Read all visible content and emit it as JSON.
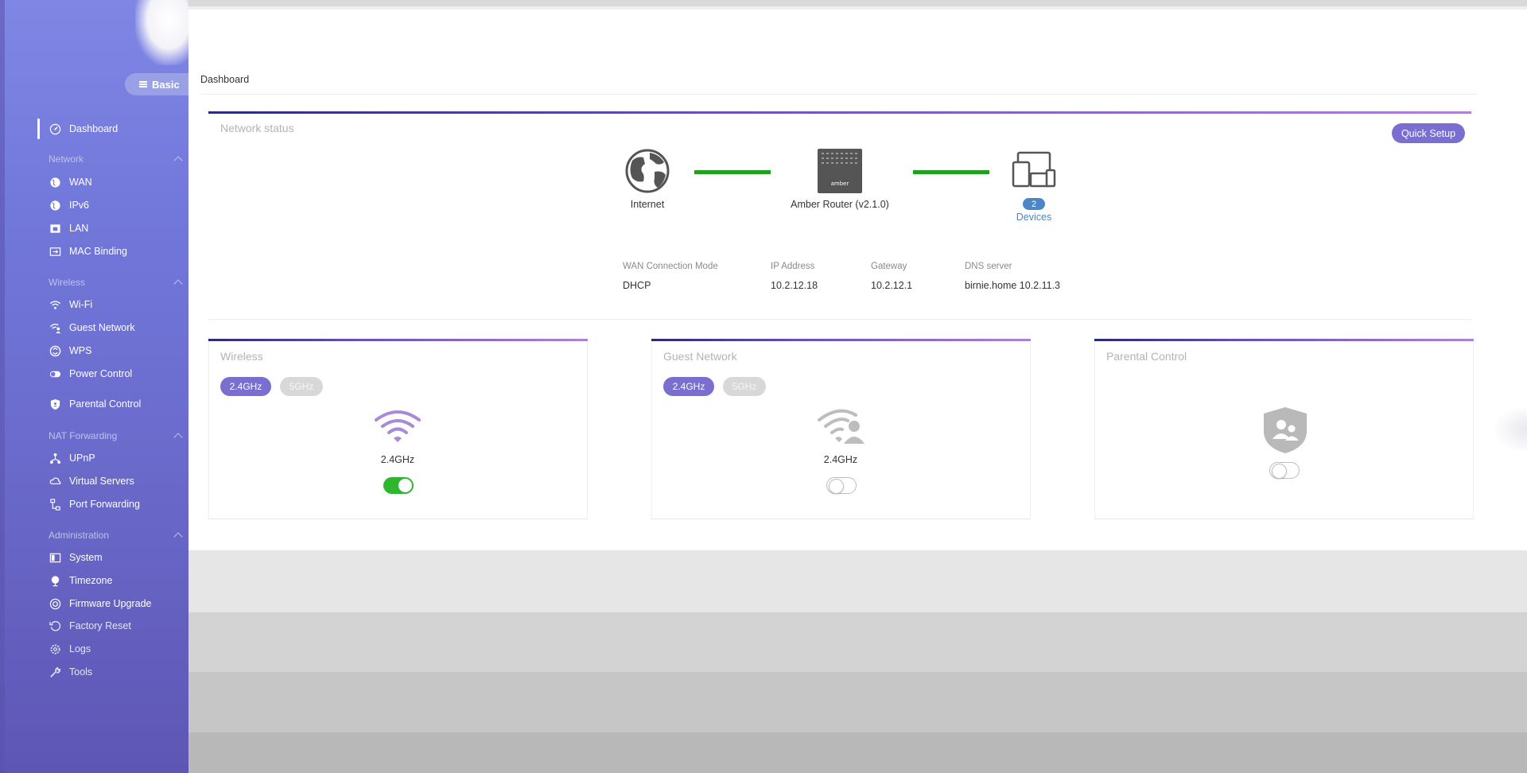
{
  "sidebar": {
    "mode_button": "Basic",
    "items": {
      "dashboard": "Dashboard",
      "wan": "WAN",
      "ipv6": "IPv6",
      "lan": "LAN",
      "mac_binding": "MAC Binding",
      "wifi": "Wi-Fi",
      "guest_network": "Guest Network",
      "wps": "WPS",
      "power_control": "Power Control",
      "parental_control": "Parental Control",
      "upnp": "UPnP",
      "virtual_servers": "Virtual Servers",
      "port_forwarding": "Port Forwarding",
      "system": "System",
      "timezone": "Timezone",
      "firmware_upgrade": "Firmware Upgrade",
      "factory_reset": "Factory Reset",
      "logs": "Logs",
      "tools": "Tools"
    },
    "sections": {
      "network": "Network",
      "wireless": "Wireless",
      "nat_forwarding": "NAT Forwarding",
      "administration": "Administration"
    }
  },
  "breadcrumb": "Dashboard",
  "network_status": {
    "title": "Network status",
    "quick_setup": "Quick Setup",
    "internet_label": "Internet",
    "router_label": "Amber Router (v2.1.0)",
    "router_brand": "amber",
    "devices_count": "2",
    "devices_label": "Devices",
    "info": {
      "wan_mode_label": "WAN Connection Mode",
      "wan_mode_value": "DHCP",
      "ip_label": "IP Address",
      "ip_value": "10.2.12.18",
      "gateway_label": "Gateway",
      "gateway_value": "10.2.12.1",
      "dns_label": "DNS server",
      "dns_value": "birnie.home 10.2.11.3"
    }
  },
  "wireless_card": {
    "title": "Wireless",
    "band_24": "2.4GHz",
    "band_5": "5GHz",
    "active_band_label": "2.4GHz",
    "enabled": true
  },
  "guest_card": {
    "title": "Guest Network",
    "band_24": "2.4GHz",
    "band_5": "5GHz",
    "active_band_label": "2.4GHz",
    "enabled": false
  },
  "parental_card": {
    "title": "Parental Control",
    "enabled": false
  },
  "colors": {
    "accent": "#7a6fd0",
    "link_green": "#1fa01f",
    "toggle_on": "#2fb52f",
    "device_blue": "#4a86c8"
  }
}
